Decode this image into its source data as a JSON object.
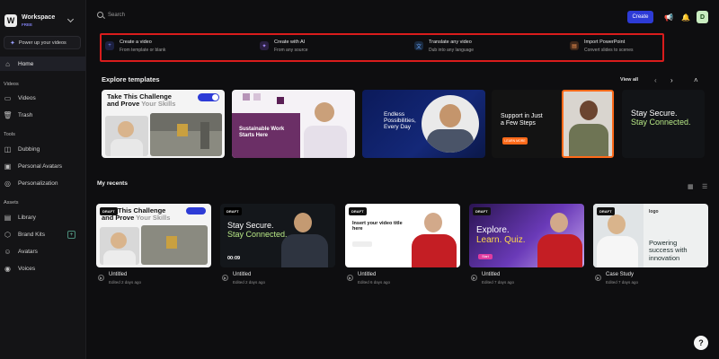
{
  "sidebar": {
    "workspace": {
      "initial": "W",
      "name": "Workspace",
      "plan": "FREE"
    },
    "powerup": "Power up your videos",
    "home": "Home",
    "sections": {
      "videos": "Videos",
      "tools": "Tools",
      "assets": "Assets"
    },
    "items": {
      "videos": "Videos",
      "trash": "Trash",
      "dubbing": "Dubbing",
      "personal_avatars": "Personal Avatars",
      "personalization": "Personalization",
      "library": "Library",
      "brand_kits": "Brand Kits",
      "avatars": "Avatars",
      "voices": "Voices"
    }
  },
  "topbar": {
    "search_placeholder": "Search",
    "create": "Create",
    "user_initial": "D",
    "icons": [
      "megaphone-icon",
      "bell-icon"
    ]
  },
  "quick_actions": [
    {
      "title": "Create a video",
      "subtitle": "From template or blank",
      "icon": "plus-icon",
      "color": "#3a4ad8"
    },
    {
      "title": "Create with AI",
      "subtitle": "From any source",
      "icon": "sparkle-icon",
      "color": "#7a5ad8"
    },
    {
      "title": "Translate any video",
      "subtitle": "Dub into any language",
      "icon": "translate-icon",
      "color": "#3a8ad8"
    },
    {
      "title": "Import PowerPoint",
      "subtitle": "Convert slides to scenes",
      "icon": "slides-icon",
      "color": "#d8843a"
    }
  ],
  "explore": {
    "title": "Explore templates",
    "view_all": "View all",
    "templates": [
      {
        "l1": "Take This Challenge",
        "l2a": "and Prove ",
        "l2b": "Your Skills",
        "badge": "DRAFT"
      },
      {
        "l1": "Sustainable Work",
        "l2": "Starts Here"
      },
      {
        "l1": "Endless",
        "l2": "Possibilities,",
        "l3": "Every Day"
      },
      {
        "l1": "Support in Just",
        "l2": "a Few Steps",
        "btn": "LEARN MORE"
      },
      {
        "l1": "Stay Secure.",
        "l2": "Stay Connected."
      }
    ]
  },
  "recents": {
    "title": "My recents",
    "items": [
      {
        "badge": "DRAFT",
        "title": "Untitled",
        "date": "Edited 2 days ago"
      },
      {
        "badge": "DRAFT",
        "title": "Untitled",
        "date": "Edited 2 days ago",
        "timer": "00:09"
      },
      {
        "badge": "DRAFT",
        "title": "Untitled",
        "date": "Edited 6 days ago"
      },
      {
        "badge": "DRAFT",
        "title": "Untitled",
        "date": "Edited 7 days ago"
      },
      {
        "badge": "DRAFT",
        "title": "Case Study",
        "date": "Edited 7 days ago"
      }
    ],
    "thumb_text": {
      "r1_l1": "This Challenge",
      "r1_l2a": "and Prove ",
      "r1_l2b": "Your Skills",
      "r2_l1": "Stay Secure.",
      "r2_l2": "Stay Connected.",
      "r3_l1": "Insert your video title",
      "r3_l2": "here",
      "r4_l1": "Explore.",
      "r4_l2": "Learn. Quiz.",
      "r4_btn": "Start",
      "r5_l1": "Powering",
      "r5_l2": "success with",
      "r5_l3": "innovation",
      "r5_logo": "logo"
    }
  },
  "help": "?"
}
